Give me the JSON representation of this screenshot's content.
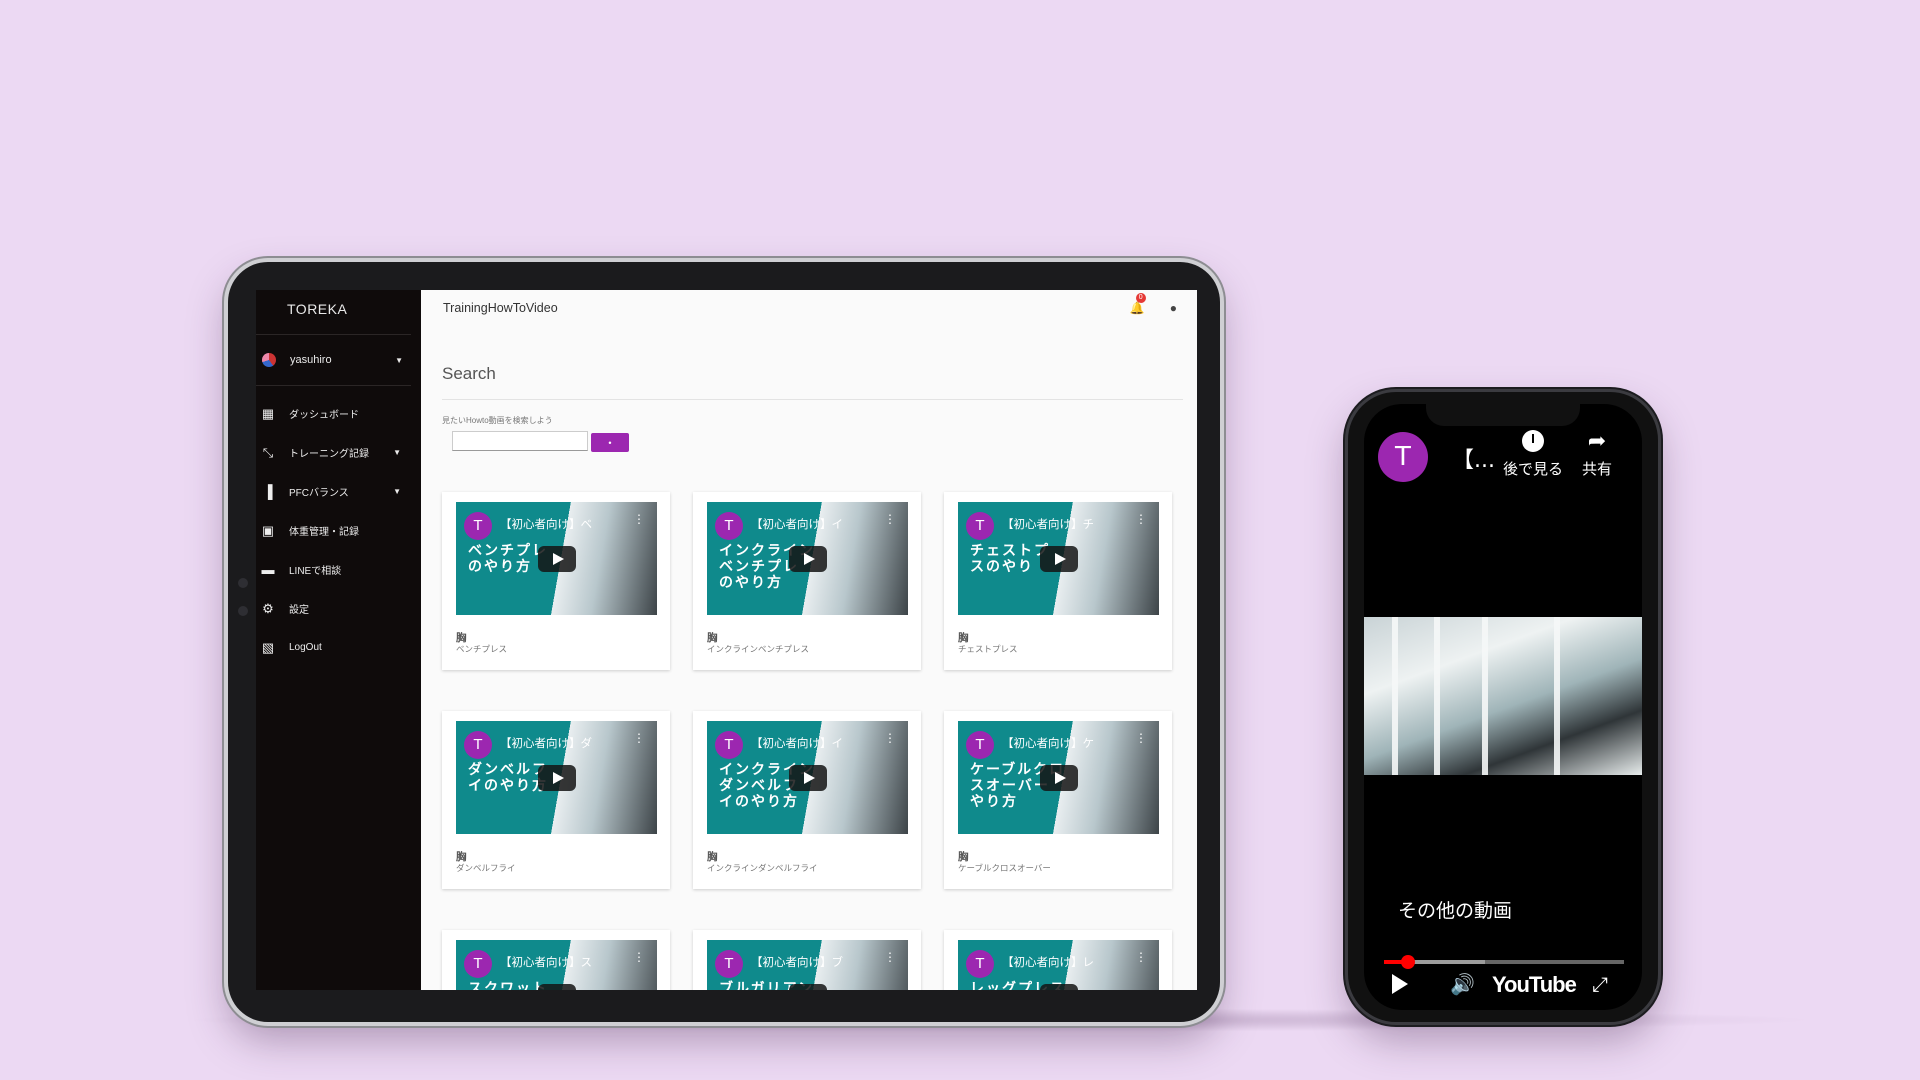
{
  "app": {
    "brand": "TOREKA",
    "page_title": "TrainingHowToVideo",
    "notification_count": "0"
  },
  "sidebar": {
    "user": "yasuhiro",
    "items": [
      {
        "label": "ダッシュボード",
        "icon": "dashboard-icon",
        "has_caret": false
      },
      {
        "label": "トレーニング記録",
        "icon": "training-icon",
        "has_caret": true
      },
      {
        "label": "PFCバランス",
        "icon": "chart-icon",
        "has_caret": true
      },
      {
        "label": "体重管理・記録",
        "icon": "weight-icon",
        "has_caret": false
      },
      {
        "label": "LINEで相談",
        "icon": "chat-icon",
        "has_caret": false
      },
      {
        "label": "設定",
        "icon": "gear-icon",
        "has_caret": false
      },
      {
        "label": "LogOut",
        "icon": "logout-icon",
        "has_caret": false
      }
    ]
  },
  "search": {
    "title": "Search",
    "hint": "見たいHowto動画を検索しよう",
    "input_value": "",
    "button_label": "•"
  },
  "videos": [
    {
      "channel_initial": "T",
      "thumb_title": "【初心者向け】ベ",
      "thumb_text": "ベンチプレ\nのやり方",
      "category": "胸",
      "name": "ベンチプレス"
    },
    {
      "channel_initial": "T",
      "thumb_title": "【初心者向け】イ",
      "thumb_text": "インクライン\nベンチプレ\nのやり方",
      "category": "胸",
      "name": "インクラインベンチプレス"
    },
    {
      "channel_initial": "T",
      "thumb_title": "【初心者向け】チ",
      "thumb_text": "チェストプ\nスのやり",
      "category": "胸",
      "name": "チェストプレス"
    },
    {
      "channel_initial": "T",
      "thumb_title": "【初心者向け】ダ",
      "thumb_text": "ダンベルフ\nイのやり方",
      "category": "胸",
      "name": "ダンベルフライ"
    },
    {
      "channel_initial": "T",
      "thumb_title": "【初心者向け】イ",
      "thumb_text": "インクライン\nダンベルフ\nイのやり方",
      "category": "胸",
      "name": "インクラインダンベルフライ"
    },
    {
      "channel_initial": "T",
      "thumb_title": "【初心者向け】ケ",
      "thumb_text": "ケーブルクロ\nスオーバー\nやり方",
      "category": "胸",
      "name": "ケーブルクロスオーバー"
    },
    {
      "channel_initial": "T",
      "thumb_title": "【初心者向け】ス",
      "thumb_text": "スクワット",
      "category": "",
      "name": ""
    },
    {
      "channel_initial": "T",
      "thumb_title": "【初心者向け】ブ",
      "thumb_text": "ブルガリアン",
      "category": "",
      "name": ""
    },
    {
      "channel_initial": "T",
      "thumb_title": "【初心者向け】レ",
      "thumb_text": "レッグプレス",
      "category": "",
      "name": ""
    }
  ],
  "phone": {
    "channel_initial": "T",
    "title": "【...",
    "watch_later": "後で見る",
    "share": "共有",
    "other_videos": "その他の動画",
    "youtube_logo": "YouTube",
    "progress_played": 0.1,
    "progress_buffered": 0.42
  },
  "colors": {
    "background": "#ecd9f3",
    "accent": "#9c27b0",
    "sidebar": "#0f0b0b",
    "thumb_teal": "#0f8a8c"
  }
}
